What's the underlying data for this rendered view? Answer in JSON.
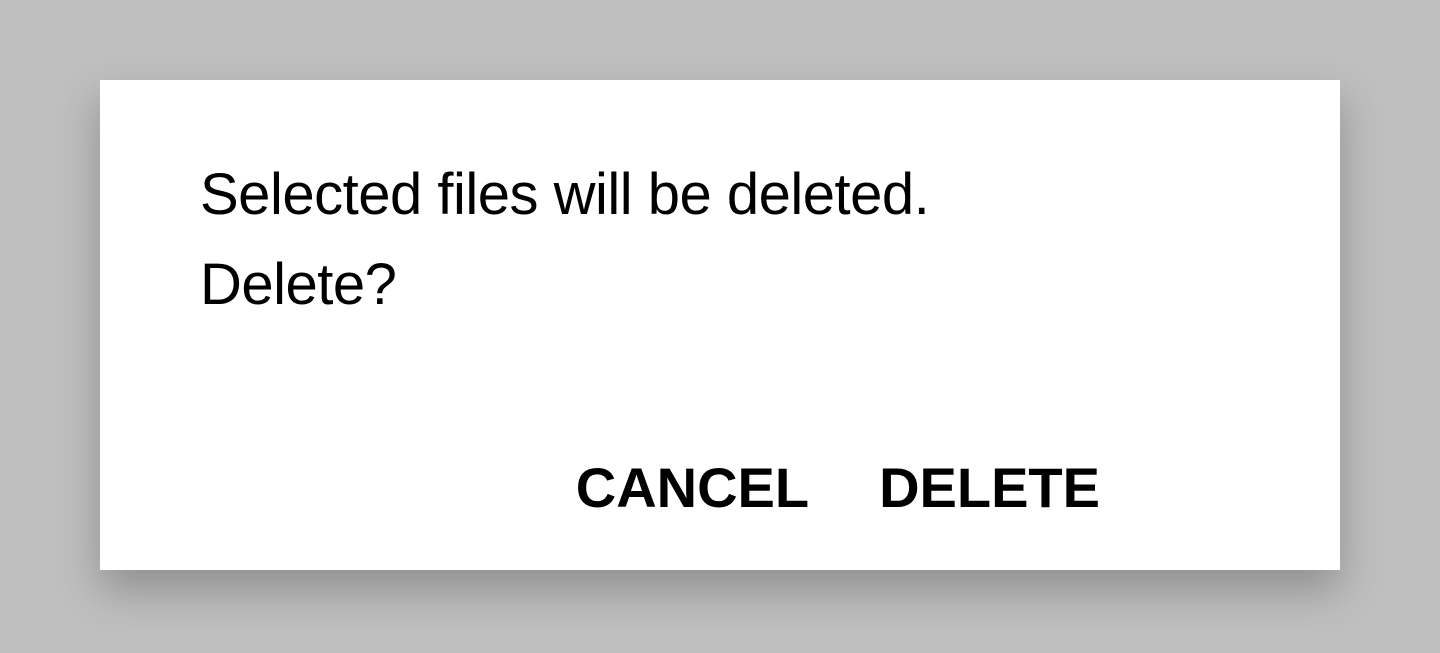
{
  "dialog": {
    "message": "Selected files will be deleted.\nDelete?",
    "cancel_label": "CANCEL",
    "delete_label": "DELETE"
  }
}
